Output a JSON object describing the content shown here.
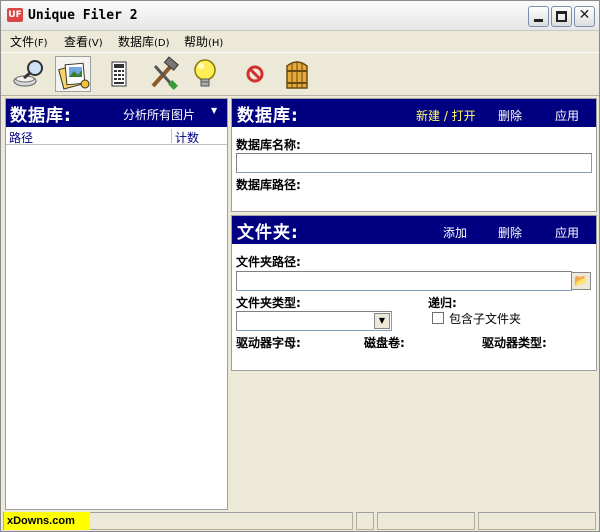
{
  "window": {
    "title": "Unique Filer 2",
    "icon_text": "UF"
  },
  "menu": [
    {
      "label": "文件",
      "accel": "(F)"
    },
    {
      "label": "查看",
      "accel": "(V)"
    },
    {
      "label": "数据库",
      "accel": "(D)"
    },
    {
      "label": "帮助",
      "accel": "(H)"
    }
  ],
  "toolbar": {
    "icons": [
      "magnifier-icon",
      "pictures-icon",
      "calculator-icon",
      "hammer-icon",
      "lightbulb-icon",
      "stop-icon",
      "door-icon"
    ]
  },
  "left_panel": {
    "title": "数据库:",
    "mode_select": "分析所有图片",
    "columns": {
      "path": "路径",
      "count": "计数"
    }
  },
  "db_panel": {
    "title": "数据库:",
    "actions": {
      "new_open": "新建 / 打开",
      "delete": "删除",
      "apply": "应用"
    },
    "name_label": "数据库名称:",
    "name_value": "",
    "path_label": "数据库路径:"
  },
  "folder_panel": {
    "title": "文件夹:",
    "actions": {
      "add": "添加",
      "delete": "删除",
      "apply": "应用"
    },
    "path_label": "文件夹路径:",
    "path_value": "",
    "type_label": "文件夹类型:",
    "type_value": "",
    "recursive_label": "递归:",
    "include_subfolders_label": "包含子文件夹",
    "include_subfolders_checked": false,
    "drive_letter_label": "驱动器字母:",
    "volume_label": "磁盘卷:",
    "drive_type_label": "驱动器类型:"
  },
  "statusbar": {
    "watermark": "xDowns.com"
  },
  "colors": {
    "header_blue": "#000080",
    "link_yellow": "#ffff66",
    "chrome": "#ece9d8"
  }
}
